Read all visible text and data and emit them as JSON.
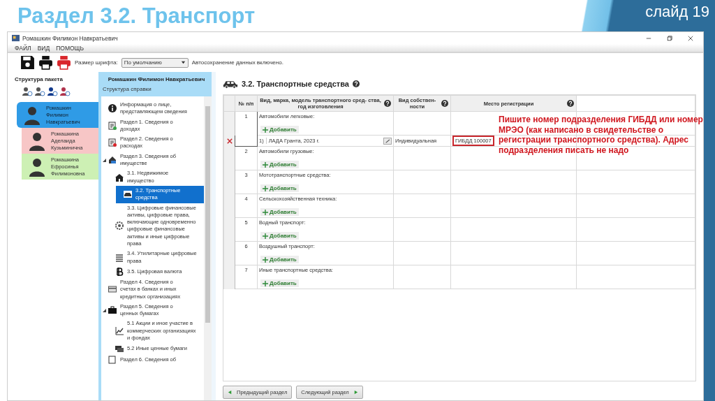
{
  "slide": {
    "title": "Раздел 3.2. Транспорт",
    "number": "слайд 19"
  },
  "window": {
    "title": "Ромашкин Филимон Навкратьевич",
    "menu": [
      "ФАЙЛ",
      "ВИД",
      "ПОМОЩЬ"
    ]
  },
  "toolbar": {
    "font_size_label": "Размер шрифта:",
    "font_size_value": "По умолчанию",
    "autosave": "Автосохранение данных включено."
  },
  "package": {
    "title": "Структура пакета",
    "people": [
      {
        "name": "Ромашкин Филимон Навкратьевич",
        "selected": true,
        "color": "#2f9be6"
      },
      {
        "name": "Ромашкина Аделаида Кузьминична",
        "selected": false,
        "color": "#f7c6c6"
      },
      {
        "name": "Ромашкина Ефросинья Филимоновна",
        "selected": false,
        "color": "#cdf0b4"
      }
    ]
  },
  "tree": {
    "header": "Ромашкин Филимон Навкратьевич",
    "subtitle": "Структура справки",
    "items": [
      {
        "label": "Информация о лице, представляющем сведения",
        "selected": false
      },
      {
        "label": "Раздел 1. Сведения о доходах",
        "selected": false
      },
      {
        "label": "Раздел 2. Сведения о расходах",
        "selected": false
      },
      {
        "label": "Раздел 3. Сведения об имуществе",
        "selected": false,
        "expanded": true,
        "children": [
          {
            "label": "3.1. Недвижимое имущество",
            "selected": false
          },
          {
            "label": "3.2. Транспортные средства",
            "selected": true
          },
          {
            "label": "3.3. Цифровые финансовые активы, цифровые права, включающие одновременно цифровые финансовые активы и иные цифровые права",
            "selected": false
          },
          {
            "label": "3.4. Утилитарные цифровые права",
            "selected": false
          },
          {
            "label": "3.5. Цифровая валюта",
            "selected": false
          }
        ]
      },
      {
        "label": "Раздел 4. Сведения о счетах в банках и иных кредитных организациях",
        "selected": false
      },
      {
        "label": "Раздел 5. Сведения о ценных бумагах",
        "selected": false,
        "expanded": true,
        "children": [
          {
            "label": "5.1 Акции и иное участие в коммерческих организациях и фондах",
            "selected": false
          },
          {
            "label": "5.2 Иные ценные бумаги",
            "selected": false
          }
        ]
      },
      {
        "label": "Раздел 6. Сведения об",
        "selected": false
      }
    ]
  },
  "section": {
    "title": "3.2. Транспортные средства",
    "columns": [
      {
        "label": "№ п/п",
        "help": false
      },
      {
        "label": "Вид, марка, модель транспортного сред- ства, год изготовления",
        "help": true
      },
      {
        "label": "Вид собствен- ности",
        "help": true
      },
      {
        "label": "Место регистрации",
        "help": true
      }
    ],
    "groups": [
      {
        "number": "1",
        "category": "Автомобили легковые:",
        "add": "Добавить",
        "entries": [
          {
            "index": "1)",
            "name": "ЛАДА Гранта, 2023 г.",
            "ownership": "Индивидуальная",
            "registration": "ГИБДД 100007",
            "highlighted": true
          }
        ]
      },
      {
        "number": "2",
        "category": "Автомобили грузовые:",
        "add": "Добавить"
      },
      {
        "number": "3",
        "category": "Мототранспортные средства:",
        "add": "Добавить"
      },
      {
        "number": "4",
        "category": "Сельскохозяйственная техника:",
        "add": "Добавить"
      },
      {
        "number": "5",
        "category": "Водный транспорт:",
        "add": "Добавить"
      },
      {
        "number": "6",
        "category": "Воздушный транспорт:",
        "add": "Добавить"
      },
      {
        "number": "7",
        "category": "Иные транспортные средства:",
        "add": "Добавить"
      }
    ],
    "annotation": "Пишите номер подразделения ГИБДД или номер МРЭО (как написано в свидетельстве о регистрации транспортного средства). Адрес подразделения писать не надо",
    "prev": "Предыдущий раздел",
    "next": "Следующий раздел"
  }
}
